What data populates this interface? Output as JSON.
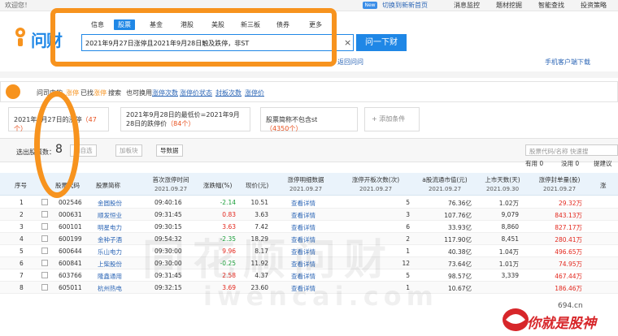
{
  "topbar": {
    "welcome": "欢迎您！",
    "new_badge": "New",
    "switch_link": "切换到新新首页",
    "links": [
      "消息监控",
      "题材挖掘",
      "智能查找",
      "投资策略"
    ]
  },
  "logo": {
    "text": "问财"
  },
  "search": {
    "tabs": [
      "信息",
      "股票",
      "基金",
      "港股",
      "美股",
      "新三板",
      "债券",
      "更多"
    ],
    "active_tab": "股票",
    "query": "2021年9月27日涨停且2021年9月28日触及跌停，非ST",
    "clear_icon": "×",
    "button": "问一下财",
    "link_under": "返回问问",
    "mobile_link": "手机客户端下载"
  },
  "hint": {
    "p1": "问司中的",
    "kw1": "涨停",
    "p2": "已找",
    "kw2": "涨停",
    "p3": "搜索",
    "p4": "也可换用",
    "links": [
      "涨停次数",
      "涨停价状态",
      "封板次数",
      "涨停价"
    ]
  },
  "conditions": [
    {
      "text": "2021年9月27日的涨停",
      "count": "（47个）"
    },
    {
      "text": "2021年9月28日的最低价=2021年9月28日的跌停价",
      "count": "（84个）"
    },
    {
      "text": "股票简称不包含st",
      "count": "（4350个）"
    }
  ],
  "add_condition": "+ 添加条件",
  "toolbar": {
    "selected_label": "选出股票数：",
    "selected_count": "8",
    "btn_add": "加自选",
    "btn_plate": "加板块",
    "btn_export": "导数据",
    "search_placeholder": "股票代码/名称 快速搜",
    "filters": [
      "有用 0",
      "没用 0",
      "提建议"
    ]
  },
  "table": {
    "headers": [
      {
        "label": "序号",
        "sub": ""
      },
      {
        "label": "股票代码",
        "sub": ""
      },
      {
        "label": "股票简称",
        "sub": ""
      },
      {
        "label": "首次涨停时间",
        "sub": "2021.09.27"
      },
      {
        "label": "涨跌幅(%)",
        "sub": ""
      },
      {
        "label": "现价(元)",
        "sub": ""
      },
      {
        "label": "涨停明细数据",
        "sub": "2021.09.27"
      },
      {
        "label": "涨停开板次数(次)",
        "sub": "2021.09.27"
      },
      {
        "label": "a股流通市值(元)",
        "sub": "2021.09.27"
      },
      {
        "label": "上市天数(天)",
        "sub": "2021.09.30"
      },
      {
        "label": "涨停封单量(股)",
        "sub": "2021.09.27"
      },
      {
        "label": "涨",
        "sub": ""
      }
    ],
    "rows": [
      {
        "idx": "1",
        "code": "002546",
        "name": "金圆股份",
        "time": "09:40:16",
        "chg": "-2.14",
        "price": "10.51",
        "detail": "查看详情",
        "opens": "5",
        "cap": "76.36亿",
        "days": "1.02万",
        "seal": "29.32万"
      },
      {
        "idx": "2",
        "code": "000631",
        "name": "顺发恒业",
        "time": "09:31:45",
        "chg": "0.83",
        "price": "3.63",
        "detail": "查看详情",
        "opens": "3",
        "cap": "107.76亿",
        "days": "9,079",
        "seal": "843.13万"
      },
      {
        "idx": "3",
        "code": "600101",
        "name": "明星电力",
        "time": "09:30:15",
        "chg": "3.63",
        "price": "7.42",
        "detail": "查看详情",
        "opens": "6",
        "cap": "33.93亿",
        "days": "8,860",
        "seal": "827.17万"
      },
      {
        "idx": "4",
        "code": "600199",
        "name": "金种子酒",
        "time": "09:54:32",
        "chg": "-2.35",
        "price": "18.29",
        "detail": "查看详情",
        "opens": "2",
        "cap": "117.90亿",
        "days": "8,451",
        "seal": "280.41万"
      },
      {
        "idx": "5",
        "code": "600644",
        "name": "乐山电力",
        "time": "09:30:00",
        "chg": "9.96",
        "price": "8.17",
        "detail": "查看详情",
        "opens": "1",
        "cap": "40.38亿",
        "days": "1.04万",
        "seal": "496.65万"
      },
      {
        "idx": "6",
        "code": "600841",
        "name": "上柴股份",
        "time": "09:30:00",
        "chg": "-0.25",
        "price": "11.92",
        "detail": "查看详情",
        "opens": "12",
        "cap": "73.64亿",
        "days": "1.01万",
        "seal": "74.95万"
      },
      {
        "idx": "7",
        "code": "603766",
        "name": "隆鑫通用",
        "time": "09:31:45",
        "chg": "2.58",
        "price": "4.37",
        "detail": "查看详情",
        "opens": "5",
        "cap": "98.57亿",
        "days": "3,339",
        "seal": "467.44万"
      },
      {
        "idx": "8",
        "code": "605011",
        "name": "杭州热电",
        "time": "09:32:15",
        "chg": "3.69",
        "price": "23.60",
        "detail": "查看详情",
        "opens": "1",
        "cap": "10.67亿",
        "days": "",
        "seal": "186.46万"
      }
    ]
  },
  "watermark": {
    "line1": "同花顺问财",
    "line2": "iwencai.com"
  },
  "corner": {
    "site": "694.cn",
    "text": "你就是股神"
  },
  "colors": {
    "accent": "#1f87e6",
    "highlight": "#f7931e",
    "up": "#e3281e",
    "down": "#1b9e3a"
  }
}
